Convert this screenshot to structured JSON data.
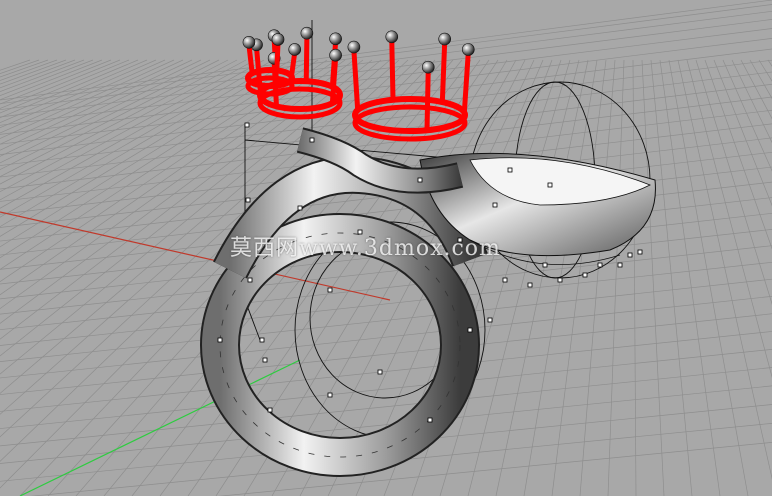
{
  "viewport": {
    "projection": "perspective",
    "background_color": "#a8a8a8",
    "grid_color": "#8e8e8e",
    "x_axis_color": "#c0392b",
    "y_axis_color": "#2ecc40"
  },
  "model": {
    "selection_color": "#ff0000",
    "surface_color": "#d0d0d0",
    "wire_color": "#111111"
  },
  "watermark": {
    "text": "莫西网www.3dmox.com"
  }
}
